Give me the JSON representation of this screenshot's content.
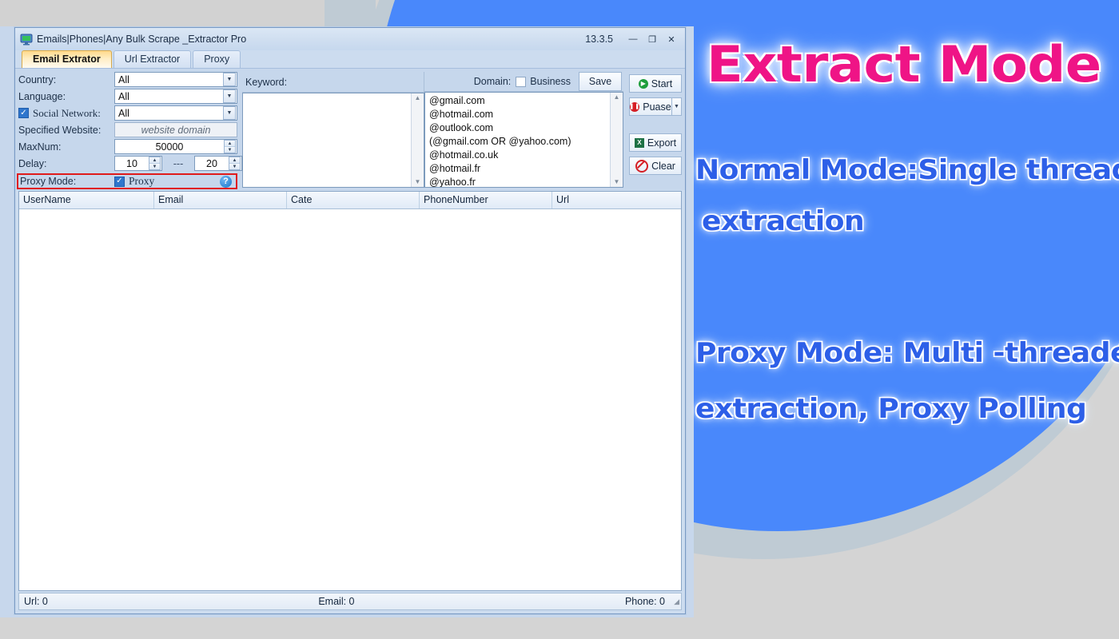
{
  "window": {
    "icon": "monitor-icon",
    "title": "Emails|Phones|Any Bulk Scrape _Extractor Pro",
    "version": "13.3.5",
    "minimize": "—",
    "maximize": "❐",
    "close": "✕"
  },
  "tabs": [
    {
      "label": "Email Extrator",
      "active": true
    },
    {
      "label": "Url Extractor",
      "active": false
    },
    {
      "label": "Proxy",
      "active": false
    }
  ],
  "form": {
    "country": {
      "label": "Country:",
      "value": "All"
    },
    "language": {
      "label": "Language:",
      "value": "All"
    },
    "social_network": {
      "label": "Social Network:",
      "value": "All",
      "checked": true
    },
    "specified_website": {
      "label": "Specified Website:",
      "placeholder": "website domain",
      "value": ""
    },
    "maxnum": {
      "label": "MaxNum:",
      "value": "50000"
    },
    "delay": {
      "label": "Delay:",
      "from": "10",
      "separator": "---",
      "to": "20"
    },
    "proxy_mode": {
      "label": "Proxy Mode:",
      "checkbox_label": "Proxy",
      "checked": true,
      "help": "?"
    }
  },
  "keyword_panel": {
    "label": "Keyword:",
    "items": []
  },
  "domain_panel": {
    "label": "Domain:",
    "business_label": "Business",
    "business_checked": false,
    "save_label": "Save",
    "items": [
      "@gmail.com",
      "@hotmail.com",
      "@outlook.com",
      "(@gmail.com OR @yahoo.com)",
      "@hotmail.co.uk",
      "@hotmail.fr",
      "@yahoo.fr"
    ]
  },
  "actions": {
    "start": {
      "label": "Start",
      "icon": "play-circle-icon",
      "color": "#1f9e3d"
    },
    "pause": {
      "label": "Puase",
      "icon": "pause-circle-icon",
      "color": "#d51f26"
    },
    "export": {
      "label": "Export",
      "icon": "excel-icon",
      "color": "#1e7145"
    },
    "clear": {
      "label": "Clear",
      "icon": "no-entry-icon",
      "color": "#d51f26"
    }
  },
  "grid": {
    "columns": [
      "UserName",
      "Email",
      "Cate",
      "PhoneNumber",
      "Url"
    ],
    "rows": []
  },
  "status": {
    "url": "Url: 0",
    "email": "Email: 0",
    "phone": "Phone: 0"
  },
  "overlay": {
    "title": "Extract Mode",
    "normal_line1": "Normal Mode:Single thread",
    "normal_line2": "extraction",
    "proxy_line1": "Proxy Mode: Multi -threaded",
    "proxy_line2": "extraction, Proxy Polling",
    "title_color": "#ef1486",
    "body_color": "#2d5fe8"
  }
}
